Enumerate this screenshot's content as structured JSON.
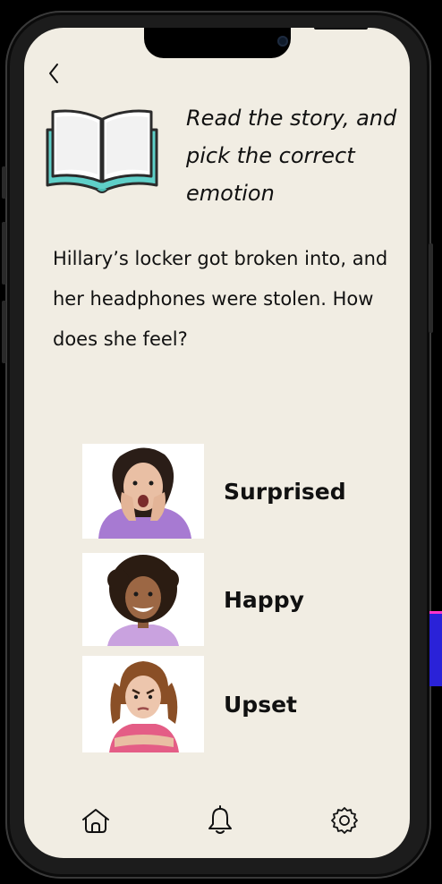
{
  "screen": {
    "instruction": "Read the story, and pick the correct emotion",
    "story": "Hillary’s locker got broken into, and her headphones were stolen. How does she feel?"
  },
  "options": [
    {
      "label": "Surprised"
    },
    {
      "label": "Happy"
    },
    {
      "label": "Upset"
    }
  ],
  "tabs": [
    {
      "icon": "home-icon"
    },
    {
      "icon": "bell-icon"
    },
    {
      "icon": "gear-icon"
    }
  ],
  "colors": {
    "background": "#f1ede3",
    "text": "#111111",
    "book_teal": "#5fcfc8"
  }
}
